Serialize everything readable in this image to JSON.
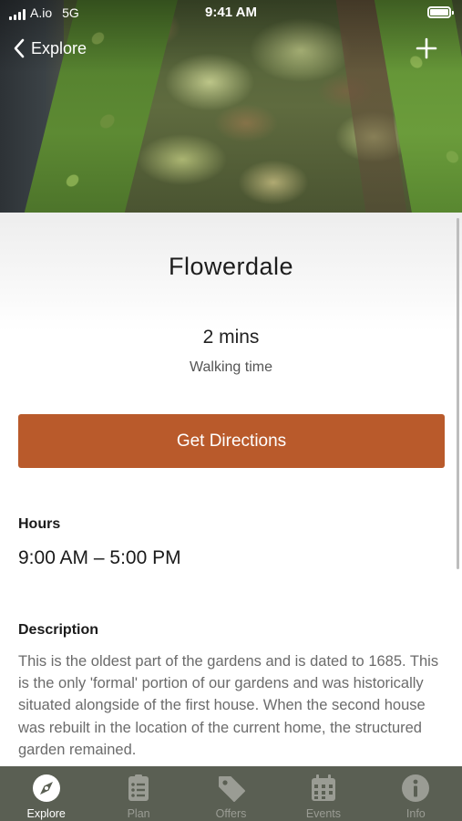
{
  "status_bar": {
    "carrier": "A.io",
    "network": "5G",
    "time": "9:41 AM"
  },
  "nav": {
    "back_label": "Explore",
    "add_icon": "plus-icon",
    "back_icon": "chevron-left-icon"
  },
  "place": {
    "title": "Flowerdale",
    "walking_time_value": "2 mins",
    "walking_time_label": "Walking time"
  },
  "directions_button": {
    "label": "Get Directions",
    "color": "#b95a2b"
  },
  "hours": {
    "label": "Hours",
    "value": "9:00 AM – 5:00 PM"
  },
  "description": {
    "label": "Description",
    "text": "This is the oldest part of the gardens and is dated to 1685. This is the only 'formal' portion of our gardens and was historically situated alongside of the first house. When the second house was rebuilt in the location of the current home, the structured garden remained."
  },
  "tab_bar": {
    "background": "#5a5f53",
    "tabs": [
      {
        "label": "Explore",
        "icon": "compass-icon",
        "active": true
      },
      {
        "label": "Plan",
        "icon": "checklist-icon",
        "active": false
      },
      {
        "label": "Offers",
        "icon": "tag-icon",
        "active": false
      },
      {
        "label": "Events",
        "icon": "calendar-icon",
        "active": false
      },
      {
        "label": "Info",
        "icon": "info-icon",
        "active": false
      }
    ]
  }
}
